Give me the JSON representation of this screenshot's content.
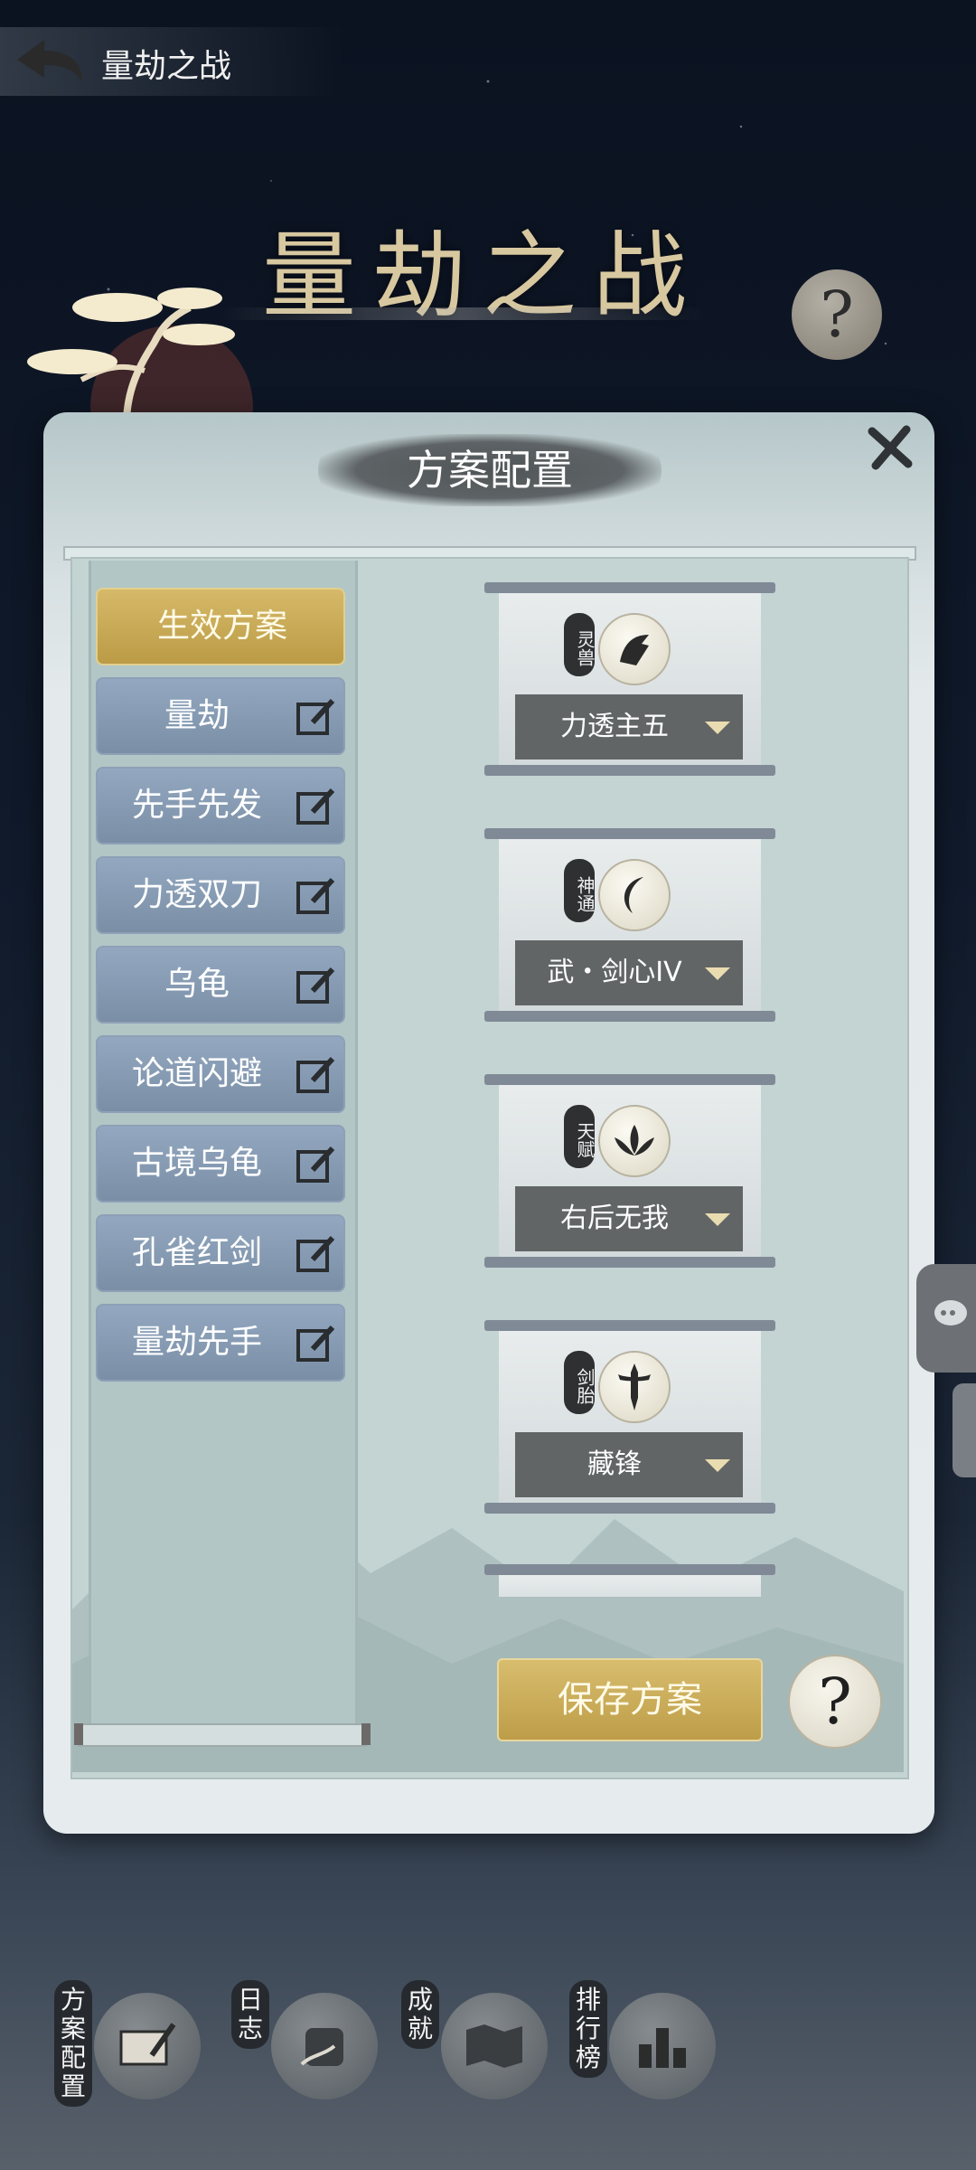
{
  "topbar": {
    "title": "量劫之战"
  },
  "header": {
    "big_title": "量劫之战"
  },
  "panel": {
    "title": "方案配置"
  },
  "plans": [
    {
      "label": "生效方案",
      "active": true
    },
    {
      "label": "量劫"
    },
    {
      "label": "先手先发"
    },
    {
      "label": "力透双刀"
    },
    {
      "label": "乌龟"
    },
    {
      "label": "论道闪避"
    },
    {
      "label": "古境乌龟"
    },
    {
      "label": "孔雀红剑"
    },
    {
      "label": "量劫先手"
    }
  ],
  "slots": [
    {
      "tag": "灵兽",
      "value": "力透主五",
      "icon": "beast-icon"
    },
    {
      "tag": "神通",
      "value": "武・剑心IV",
      "icon": "crescent-icon"
    },
    {
      "tag": "天赋",
      "value": "右后无我",
      "icon": "lotus-icon"
    },
    {
      "tag": "剑胎",
      "value": "藏锋",
      "icon": "sword-icon"
    }
  ],
  "buttons": {
    "save": "保存方案",
    "help": "?"
  },
  "bottom_nav": [
    {
      "label": "方案配置",
      "icon": "scroll-brush-icon"
    },
    {
      "label": "日志",
      "icon": "scroll-icon"
    },
    {
      "label": "成就",
      "icon": "map-scroll-icon"
    },
    {
      "label": "排行榜",
      "icon": "bars-icon"
    }
  ],
  "colors": {
    "gold": "#c8a855",
    "slate": "#7a8fa6",
    "panel": "#c3d4d3"
  }
}
